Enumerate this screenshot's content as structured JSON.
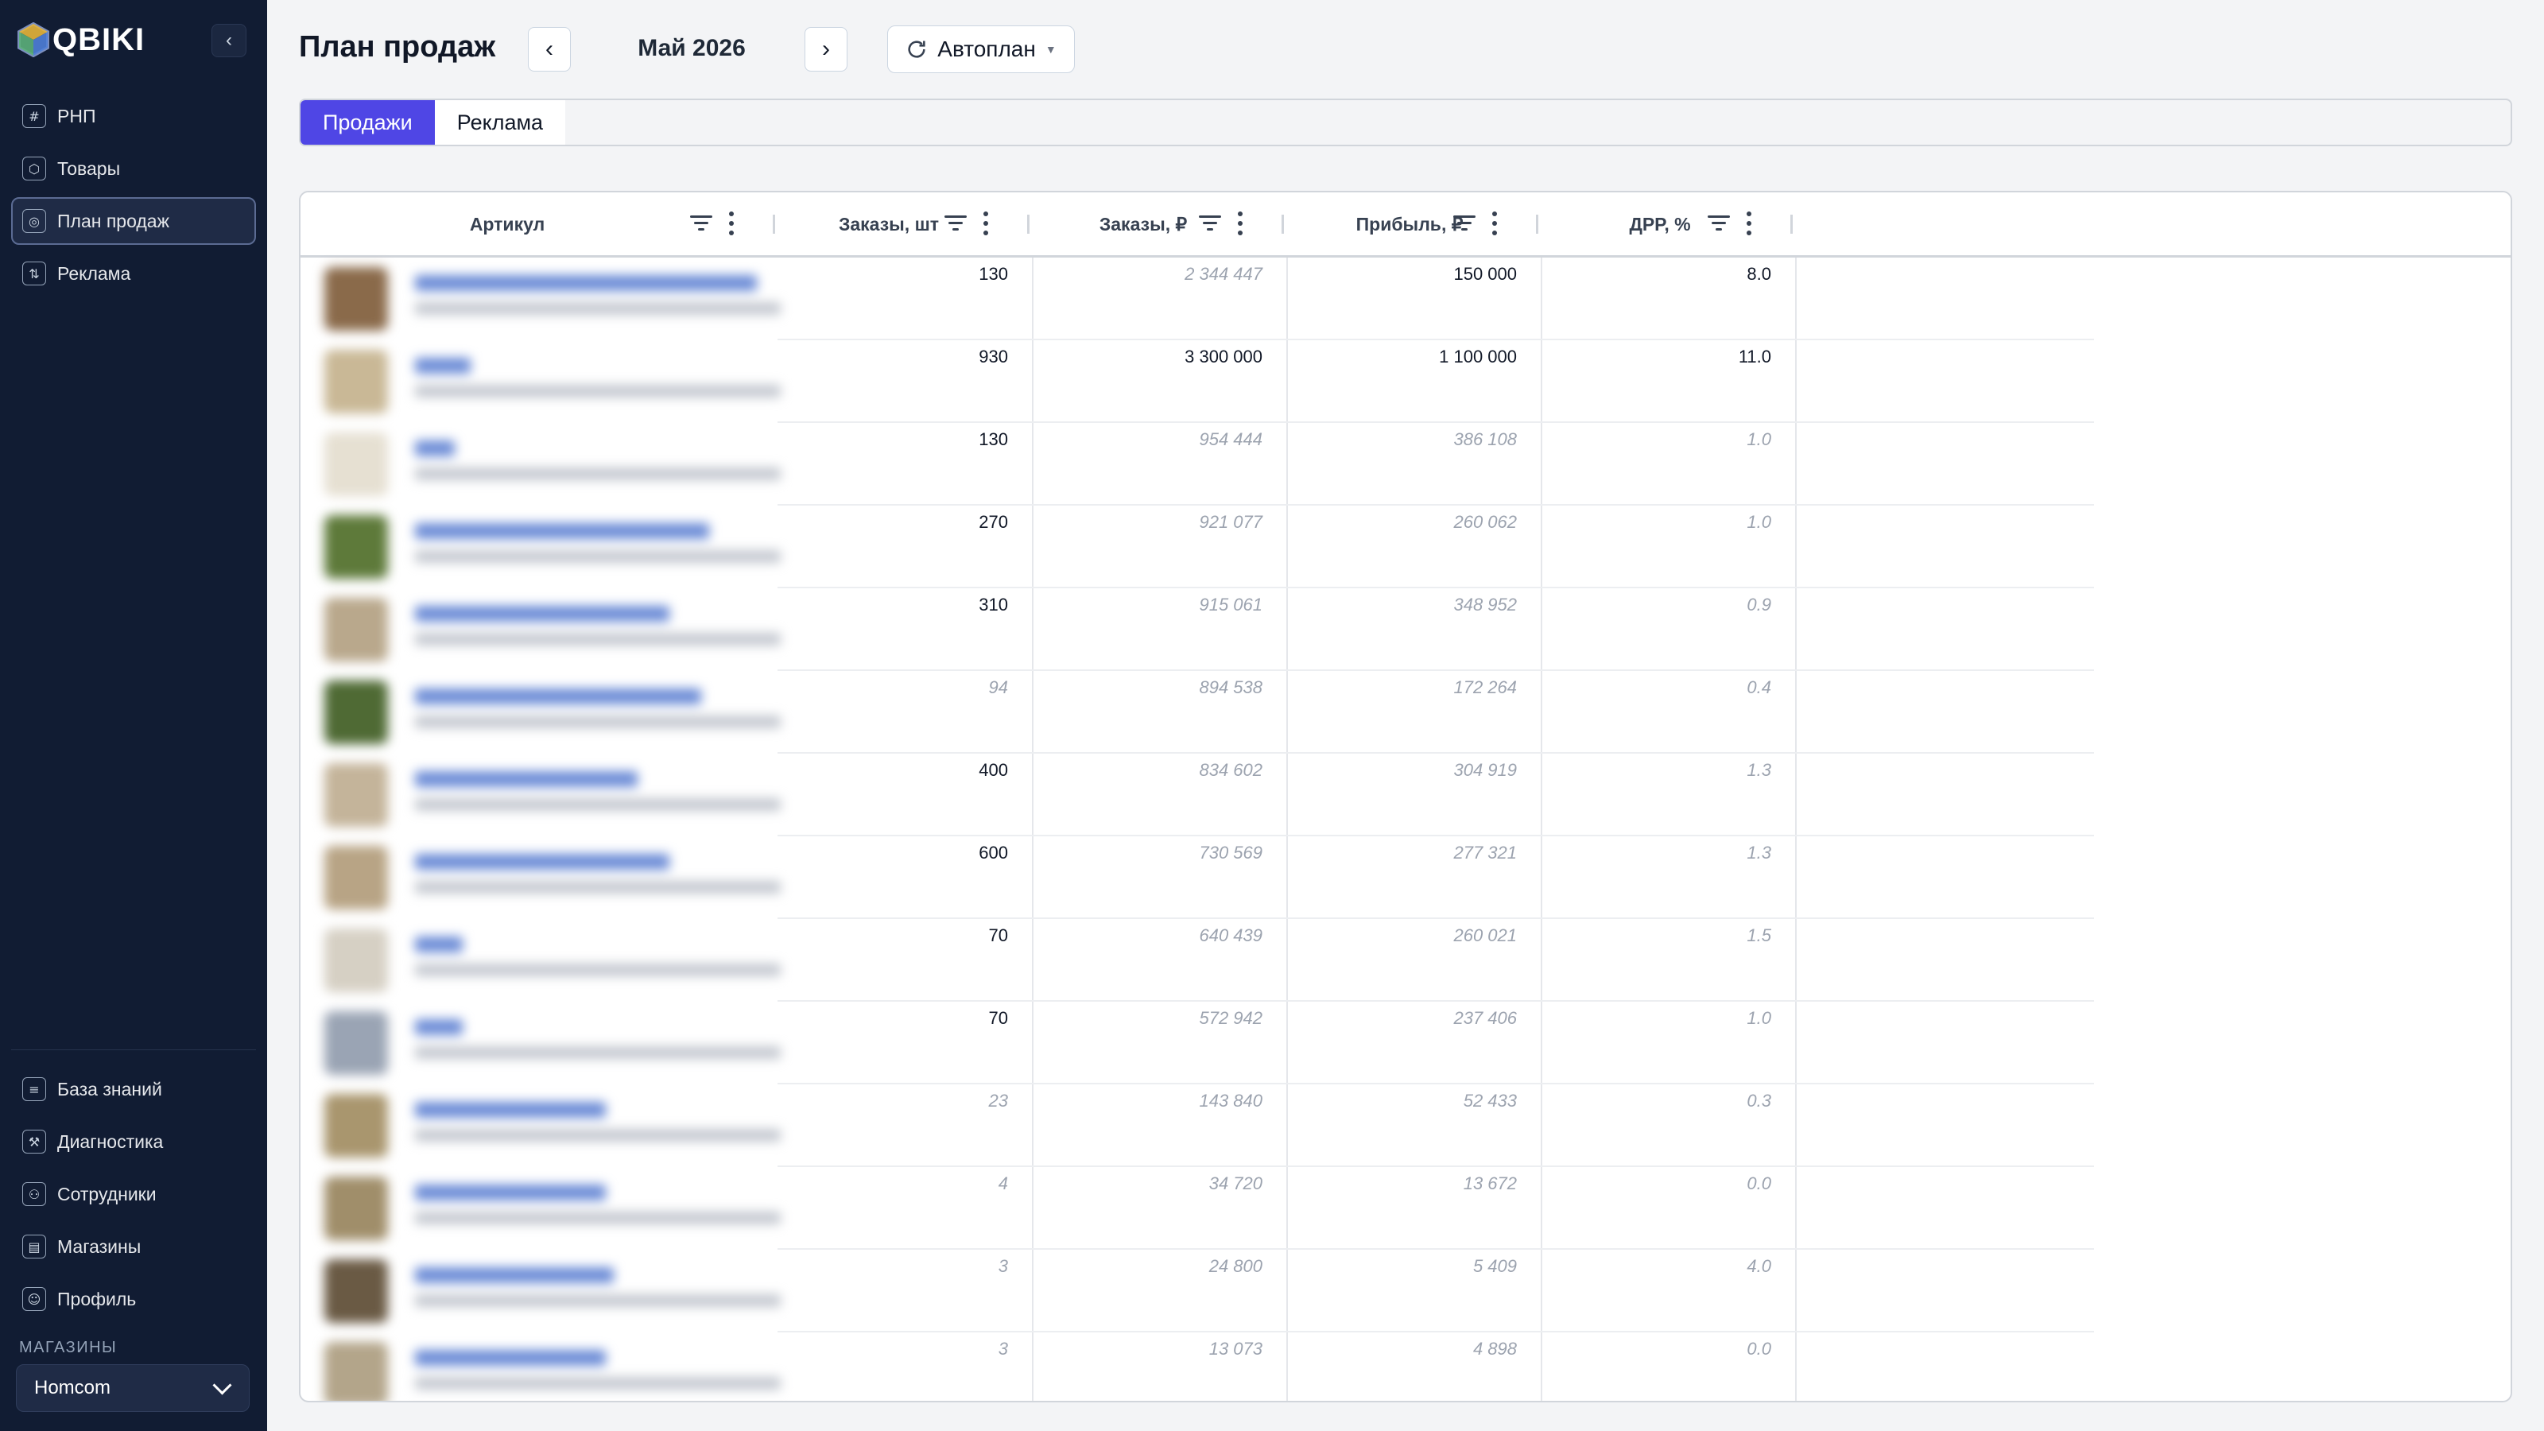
{
  "app": {
    "logo_text": "QBIKI",
    "page_title": "План продаж",
    "month": "Май 2026",
    "autoplan_label": "Автоплан",
    "accent_color": "#4f46e5"
  },
  "sidebar": {
    "top_items": [
      {
        "label": "РНП",
        "icon": "grid-icon",
        "active": false
      },
      {
        "label": "Товары",
        "icon": "box-icon",
        "active": false
      },
      {
        "label": "План продаж",
        "icon": "target-icon",
        "active": true
      },
      {
        "label": "Реклама",
        "icon": "ads-icon",
        "active": false
      }
    ],
    "bottom_items": [
      {
        "label": "База знаний",
        "icon": "book-icon"
      },
      {
        "label": "Диагностика",
        "icon": "wrench-icon"
      },
      {
        "label": "Сотрудники",
        "icon": "users-icon"
      },
      {
        "label": "Магазины",
        "icon": "store-icon"
      },
      {
        "label": "Профиль",
        "icon": "user-icon"
      }
    ],
    "stores_label": "МАГАЗИНЫ",
    "selected_store": "Homcom"
  },
  "tabs": [
    {
      "label": "Продажи",
      "active": true
    },
    {
      "label": "Реклама",
      "active": false
    }
  ],
  "table": {
    "columns": [
      "Артикул",
      "Заказы, шт",
      "Заказы, ₽",
      "Прибыль, ₽",
      "ДРР, %"
    ],
    "rows": [
      {
        "qty": "130",
        "rub": "2 344 447",
        "profit": "150 000",
        "drr": "8.0",
        "qty_set": true,
        "rub_set": false,
        "profit_set": true,
        "drr_set": true
      },
      {
        "qty": "930",
        "rub": "3 300 000",
        "profit": "1 100 000",
        "drr": "11.0",
        "qty_set": true,
        "rub_set": true,
        "profit_set": true,
        "drr_set": true
      },
      {
        "qty": "130",
        "rub": "954 444",
        "profit": "386 108",
        "drr": "1.0",
        "qty_set": true,
        "rub_set": false,
        "profit_set": false,
        "drr_set": false
      },
      {
        "qty": "270",
        "rub": "921 077",
        "profit": "260 062",
        "drr": "1.0",
        "qty_set": true,
        "rub_set": false,
        "profit_set": false,
        "drr_set": false
      },
      {
        "qty": "310",
        "rub": "915 061",
        "profit": "348 952",
        "drr": "0.9",
        "qty_set": true,
        "rub_set": false,
        "profit_set": false,
        "drr_set": false
      },
      {
        "qty": "94",
        "rub": "894 538",
        "profit": "172 264",
        "drr": "0.4",
        "qty_set": false,
        "rub_set": false,
        "profit_set": false,
        "drr_set": false
      },
      {
        "qty": "400",
        "rub": "834 602",
        "profit": "304 919",
        "drr": "1.3",
        "qty_set": true,
        "rub_set": false,
        "profit_set": false,
        "drr_set": false
      },
      {
        "qty": "600",
        "rub": "730 569",
        "profit": "277 321",
        "drr": "1.3",
        "qty_set": true,
        "rub_set": false,
        "profit_set": false,
        "drr_set": false
      },
      {
        "qty": "70",
        "rub": "640 439",
        "profit": "260 021",
        "drr": "1.5",
        "qty_set": true,
        "rub_set": false,
        "profit_set": false,
        "drr_set": false
      },
      {
        "qty": "70",
        "rub": "572 942",
        "profit": "237 406",
        "drr": "1.0",
        "qty_set": true,
        "rub_set": false,
        "profit_set": false,
        "drr_set": false
      },
      {
        "qty": "23",
        "rub": "143 840",
        "profit": "52 433",
        "drr": "0.3",
        "qty_set": false,
        "rub_set": false,
        "profit_set": false,
        "drr_set": false
      },
      {
        "qty": "4",
        "rub": "34 720",
        "profit": "13 672",
        "drr": "0.0",
        "qty_set": false,
        "rub_set": false,
        "profit_set": false,
        "drr_set": false
      },
      {
        "qty": "3",
        "rub": "24 800",
        "profit": "5 409",
        "drr": "4.0",
        "qty_set": false,
        "rub_set": false,
        "profit_set": false,
        "drr_set": false
      },
      {
        "qty": "3",
        "rub": "13 073",
        "profit": "4 898",
        "drr": "0.0",
        "qty_set": false,
        "rub_set": false,
        "profit_set": false,
        "drr_set": false
      }
    ]
  }
}
